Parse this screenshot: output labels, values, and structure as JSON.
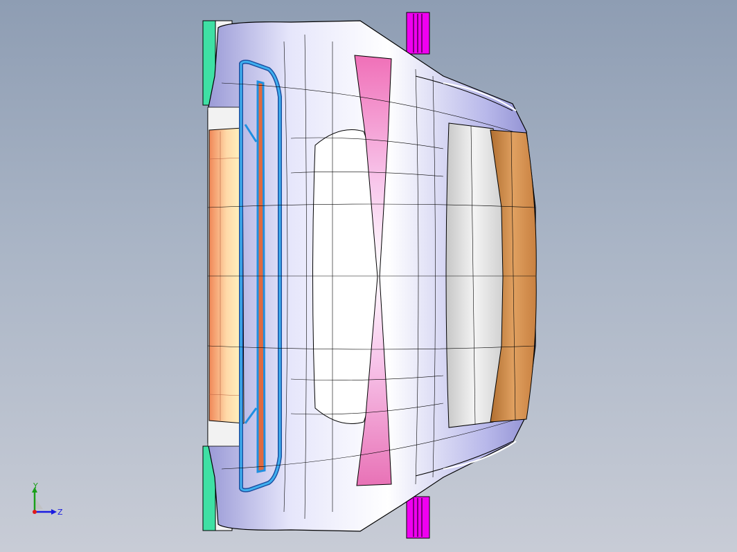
{
  "viewport": {
    "background_top": "#8e9db3",
    "background_bottom": "#c8ccd6",
    "model": "car-front-surface-mesh"
  },
  "colors": {
    "body_surface": "#d2d2f2",
    "body_shadow": "#8f8fd0",
    "headlamp_orange": "#f6a884",
    "grille_blue": "#1f8fe0",
    "pillar_pink": "#f07ac4",
    "bumper_amber": "#cf8a44",
    "window_gray": "#dedede",
    "mirror_green": "#3fe0a4",
    "marker_magenta": "#f000f0"
  },
  "triad": {
    "y_label": "Y",
    "z_label": "Z",
    "y_color": "#1aa01a",
    "z_color": "#1a1ae0",
    "x_color": "#e01a1a"
  }
}
